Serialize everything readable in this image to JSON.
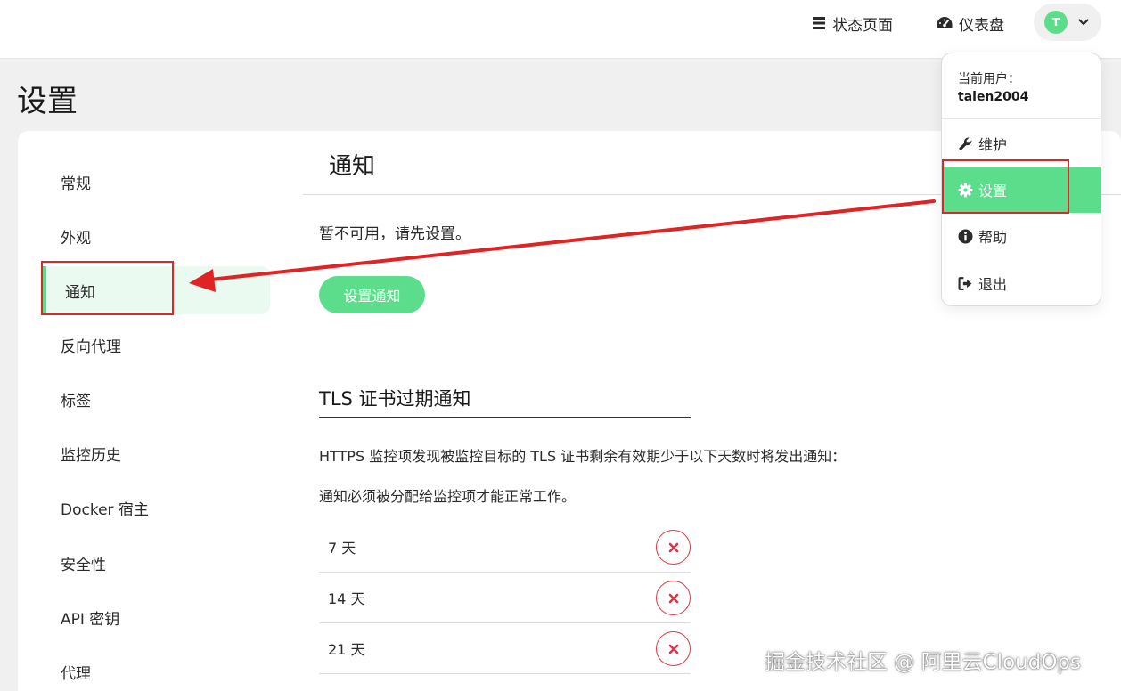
{
  "header": {
    "status_page_label": "状态页面",
    "dashboard_label": "仪表盘",
    "avatar_initial": "T"
  },
  "page": {
    "title": "设置"
  },
  "sidebar": {
    "items": [
      {
        "label": "常规"
      },
      {
        "label": "外观"
      },
      {
        "label": "通知"
      },
      {
        "label": "反向代理"
      },
      {
        "label": "标签"
      },
      {
        "label": "监控历史"
      },
      {
        "label": "Docker 宿主"
      },
      {
        "label": "安全性"
      },
      {
        "label": "API 密钥"
      },
      {
        "label": "代理"
      }
    ],
    "active": "通知"
  },
  "main": {
    "title": "通知",
    "unavailable_text": "暂不可用，请先设置。",
    "setup_button": "设置通知",
    "tls": {
      "heading": "TLS 证书过期通知",
      "description": "HTTPS 监控项发现被监控目标的 TLS 证书剩余有效期少于以下天数时将发出通知：",
      "note": "通知必须被分配给监控项才能正常工作。",
      "days": [
        {
          "label": "7 天"
        },
        {
          "label": "14 天"
        },
        {
          "label": "21 天"
        }
      ]
    }
  },
  "dropdown": {
    "current_user_label": "当前用户：",
    "username": "talen2004",
    "items": [
      {
        "label": "维护",
        "icon": "wrench-icon"
      },
      {
        "label": "设置",
        "icon": "gear-icon"
      },
      {
        "label": "帮助",
        "icon": "info-icon"
      },
      {
        "label": "退出",
        "icon": "sign-out-icon"
      }
    ],
    "active": "设置"
  },
  "watermark": "掘金技术社区 @ 阿里云CloudOps",
  "colors": {
    "accent": "#5cdd8b",
    "annotation_red": "#d42a2a",
    "danger": "#dc3545"
  }
}
